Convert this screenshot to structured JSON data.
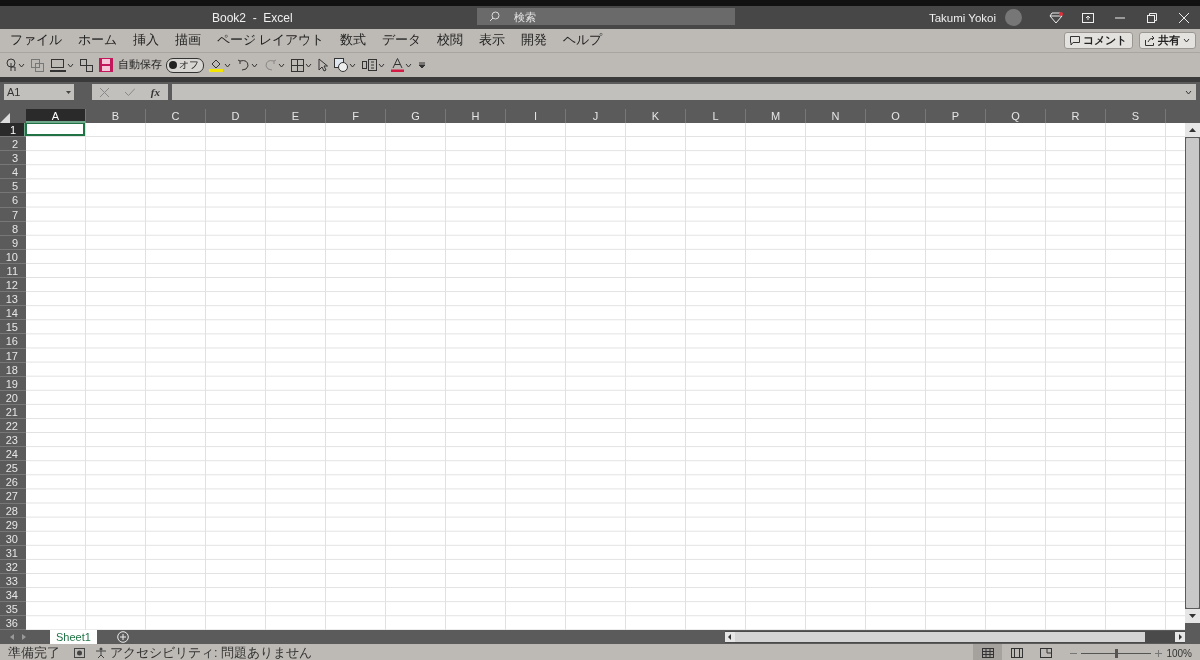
{
  "window": {
    "title": "Book2  -  Excel",
    "user": "Takumi Yokoi"
  },
  "search": {
    "placeholder": "検索"
  },
  "menu": [
    "ファイル",
    "ホーム",
    "挿入",
    "描画",
    "ページ レイアウト",
    "数式",
    "データ",
    "校閲",
    "表示",
    "開発",
    "ヘルプ"
  ],
  "comment_button": "コメント",
  "share_button": "共有",
  "toolbar": {
    "autosave_label": "自動保存",
    "autosave_toggle": {
      "label": "オフ",
      "on": false
    }
  },
  "name_box": {
    "value": "A1"
  },
  "formula_bar": {
    "function_label": "fx"
  },
  "columns": [
    {
      "label": "A",
      "selected": true
    },
    {
      "label": "B",
      "selected": false
    },
    {
      "label": "C",
      "selected": false
    },
    {
      "label": "D",
      "selected": false
    },
    {
      "label": "E",
      "selected": false
    },
    {
      "label": "F",
      "selected": false
    },
    {
      "label": "G",
      "selected": false
    },
    {
      "label": "H",
      "selected": false
    },
    {
      "label": "I",
      "selected": false
    },
    {
      "label": "J",
      "selected": false
    },
    {
      "label": "K",
      "selected": false
    },
    {
      "label": "L",
      "selected": false
    },
    {
      "label": "M",
      "selected": false
    },
    {
      "label": "N",
      "selected": false
    },
    {
      "label": "O",
      "selected": false
    },
    {
      "label": "P",
      "selected": false
    },
    {
      "label": "Q",
      "selected": false
    },
    {
      "label": "R",
      "selected": false
    },
    {
      "label": "S",
      "selected": false
    }
  ],
  "rows": [
    {
      "label": "1",
      "selected": true
    },
    {
      "label": "2",
      "selected": false
    },
    {
      "label": "3",
      "selected": false
    },
    {
      "label": "4",
      "selected": false
    },
    {
      "label": "5",
      "selected": false
    },
    {
      "label": "6",
      "selected": false
    },
    {
      "label": "7",
      "selected": false
    },
    {
      "label": "8",
      "selected": false
    },
    {
      "label": "9",
      "selected": false
    },
    {
      "label": "10",
      "selected": false
    },
    {
      "label": "11",
      "selected": false
    },
    {
      "label": "12",
      "selected": false
    },
    {
      "label": "13",
      "selected": false
    },
    {
      "label": "14",
      "selected": false
    },
    {
      "label": "15",
      "selected": false
    },
    {
      "label": "16",
      "selected": false
    },
    {
      "label": "17",
      "selected": false
    },
    {
      "label": "18",
      "selected": false
    },
    {
      "label": "19",
      "selected": false
    },
    {
      "label": "20",
      "selected": false
    },
    {
      "label": "21",
      "selected": false
    },
    {
      "label": "22",
      "selected": false
    },
    {
      "label": "23",
      "selected": false
    },
    {
      "label": "24",
      "selected": false
    },
    {
      "label": "25",
      "selected": false
    },
    {
      "label": "26",
      "selected": false
    },
    {
      "label": "27",
      "selected": false
    },
    {
      "label": "28",
      "selected": false
    },
    {
      "label": "29",
      "selected": false
    },
    {
      "label": "30",
      "selected": false
    },
    {
      "label": "31",
      "selected": false
    },
    {
      "label": "32",
      "selected": false
    },
    {
      "label": "33",
      "selected": false
    },
    {
      "label": "34",
      "selected": false
    },
    {
      "label": "35",
      "selected": false
    },
    {
      "label": "36",
      "selected": false
    }
  ],
  "sheet_tabs": [
    {
      "label": "Sheet1",
      "selected": true
    }
  ],
  "status_bar": {
    "status": "準備完了",
    "accessibility": "アクセシビリティ: 問題ありません",
    "views": [
      {
        "kind": "normal",
        "selected": true
      },
      {
        "kind": "page-layout",
        "selected": false
      },
      {
        "kind": "page-break",
        "selected": false
      }
    ],
    "zoom": {
      "level": 0.5,
      "reading": "100%"
    }
  }
}
